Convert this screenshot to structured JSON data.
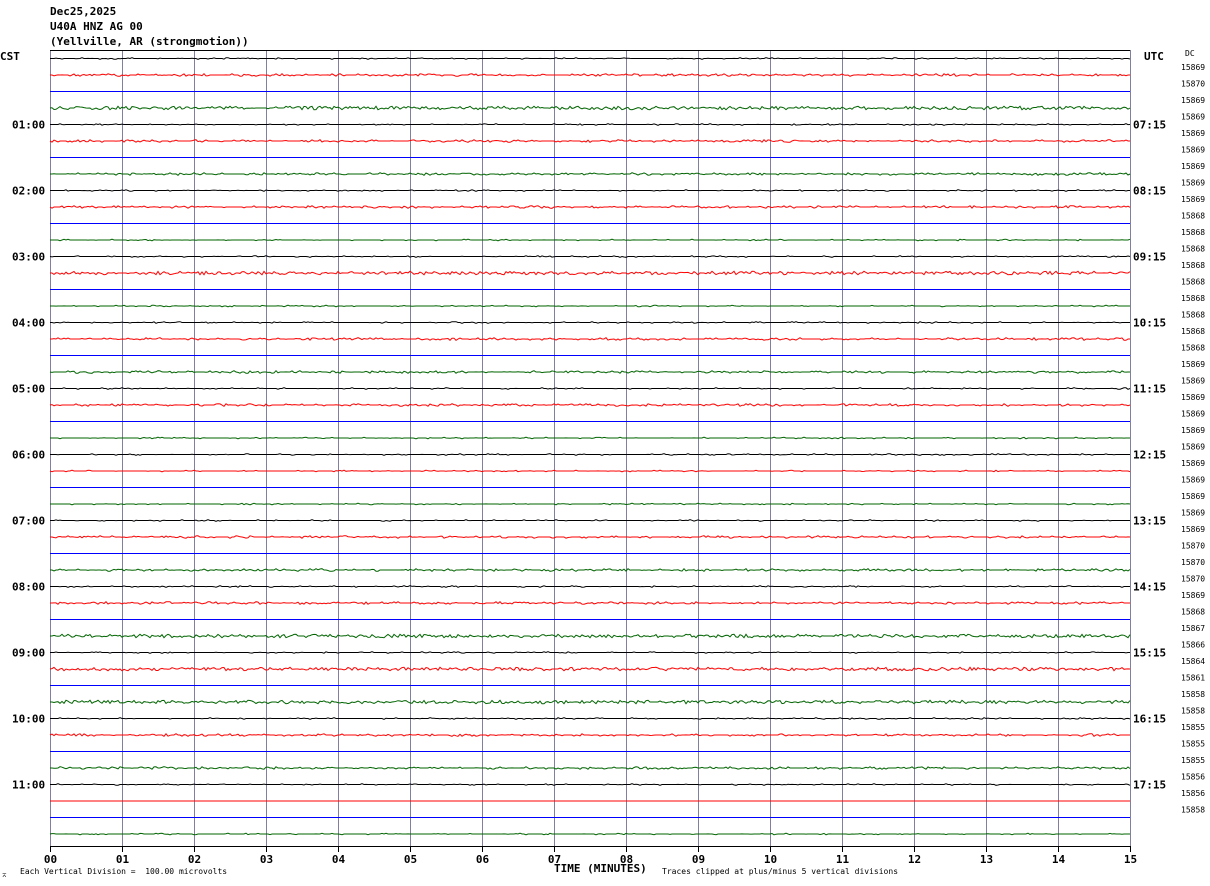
{
  "header": {
    "date": "Dec25,2025",
    "station": "U40A HNZ AG 00",
    "location": "(Yellville, AR (strongmotion))"
  },
  "left_tz_label": "CST",
  "right_tz_label": "UTC",
  "dc_label": "DC",
  "footer": {
    "xlabel": "TIME (MINUTES)",
    "scale_note": "Each Vertical Division =  100.00 microvolts",
    "clip_note": "Traces clipped at plus/minus 5 vertical divisions"
  },
  "colors": {
    "black": "#000000",
    "red": "#ff0000",
    "blue": "#0000ff",
    "green": "#006400",
    "grid": "#7f7f9f"
  },
  "chart_data": {
    "type": "line",
    "title": "U40A HNZ AG 00",
    "xlabel": "TIME (MINUTES)",
    "xlim": [
      0,
      15
    ],
    "x_ticks": [
      "00",
      "01",
      "02",
      "03",
      "04",
      "05",
      "06",
      "07",
      "08",
      "09",
      "10",
      "11",
      "12",
      "13",
      "14",
      "15"
    ],
    "trace_colors_cycle": [
      "black",
      "red",
      "blue",
      "green"
    ],
    "left_hour_labels": [
      "01:00",
      "02:00",
      "03:00",
      "04:00",
      "05:00",
      "06:00",
      "07:00",
      "08:00",
      "09:00",
      "10:00",
      "11:00"
    ],
    "right_hour_labels": [
      "07:15",
      "08:15",
      "09:15",
      "10:15",
      "11:15",
      "12:15",
      "13:15",
      "14:15",
      "15:15",
      "16:15",
      "17:15"
    ],
    "dc_values": [
      15869,
      15870,
      15869,
      15869,
      15869,
      15869,
      15869,
      15869,
      15869,
      15868,
      15868,
      15868,
      15868,
      15868,
      15868,
      15868,
      15868,
      15868,
      15869,
      15869,
      15869,
      15869,
      15869,
      15869,
      15869,
      15869,
      15869,
      15869,
      15869,
      15870,
      15870,
      15870,
      15869,
      15868,
      15867,
      15866,
      15864,
      15861,
      15858,
      15858,
      15855,
      15855,
      15855,
      15856,
      15856,
      15858
    ],
    "noise_level": [
      1,
      2,
      0,
      3,
      1,
      2,
      0,
      2,
      1,
      2,
      0,
      1,
      1,
      3,
      0,
      1,
      1,
      2,
      0,
      2,
      1,
      2,
      0,
      1,
      1,
      1,
      0,
      1,
      1,
      2,
      0,
      2,
      1,
      2,
      0,
      3,
      1,
      3,
      0,
      3,
      1,
      2,
      0,
      2,
      1,
      0,
      0,
      1
    ]
  }
}
